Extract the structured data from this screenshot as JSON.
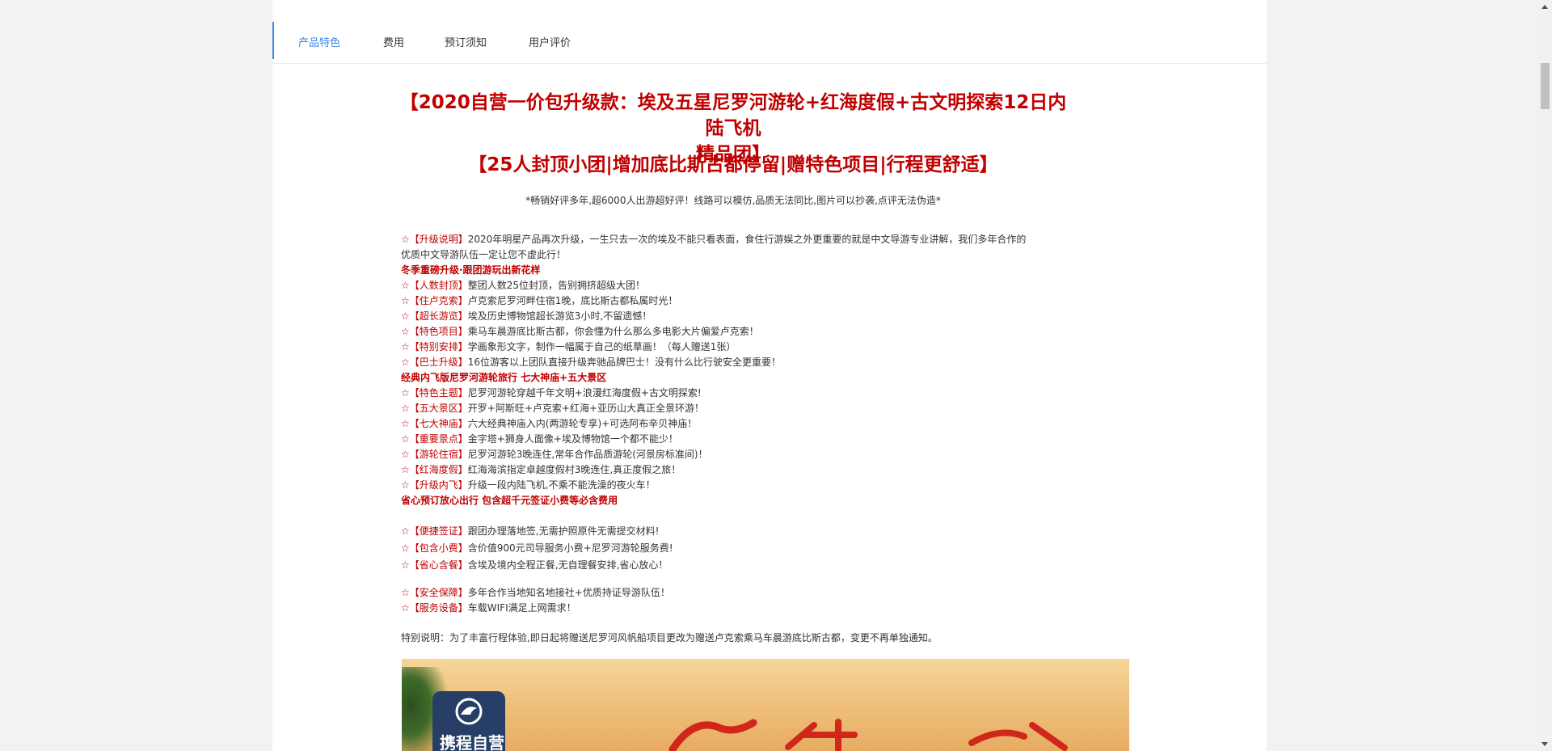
{
  "tabs": [
    {
      "label": "产品特色"
    },
    {
      "label": "费用"
    },
    {
      "label": "预订须知"
    },
    {
      "label": "用户评价"
    }
  ],
  "title_line1": "【2020自营一价包升级款：埃及五星尼罗河游轮+红海度假+古文明探索12日内陆飞机",
  "title_line2": "精品团】",
  "subtitle": "【25人封顶小团|增加底比斯古都停留|赠特色项目|行程更舒适】",
  "slogan": "*畅销好评多年,超6000人出游超好评！线路可以模仿,品质无法同比,图片可以抄袭,点评无法伪造*",
  "star": "☆",
  "section1": {
    "intro_tag": "【升级说明】",
    "intro_text": "2020年明星产品再次升级，一生只去一次的埃及不能只看表面，食住行游娱之外更重要的就是中文导游专业讲解，我们多年合作的",
    "intro_text2": "优质中文导游队伍一定让您不虚此行！",
    "heading": "冬季重磅升级·跟团游玩出新花样",
    "items": [
      {
        "tag": "【人数封顶】",
        "text": "整团人数25位封顶，告别拥挤超级大团！"
      },
      {
        "tag": "【住卢克索】",
        "text": "卢克索尼罗河畔住宿1晚，底比斯古都私属时光！"
      },
      {
        "tag": "【超长游览】",
        "text": "埃及历史博物馆超长游览3小时,不留遗憾！"
      },
      {
        "tag": "【特色项目】",
        "text": "乘马车晨游底比斯古都，你会懂为什么那么多电影大片偏爱卢克索！"
      },
      {
        "tag": "【特别安排】",
        "text": "学画象形文字，制作一幅属于自己的纸草画！（每人赠送1张）"
      },
      {
        "tag": "【巴士升级】",
        "text": "16位游客以上团队直接升级奔驰品牌巴士！没有什么比行驶安全更重要！"
      }
    ]
  },
  "section2": {
    "heading": " 经典内飞版尼罗河游轮旅行 七大神庙+五大景区",
    "items": [
      {
        "tag": "【特色主题】",
        "text": "尼罗河游轮穿越千年文明+浪漫红海度假+古文明探索!"
      },
      {
        "tag": "【五大景区】",
        "text": "开罗+阿斯旺+卢克索+红海+亚历山大真正全景环游！"
      },
      {
        "tag": "【七大神庙】",
        "text": "六大经典神庙入内(两游轮专享)+可选阿布辛贝神庙！"
      },
      {
        "tag": "【重要景点】",
        "text": "金字塔+狮身人面像+埃及博物馆一个都不能少！"
      },
      {
        "tag": "【游轮住宿】",
        "text": "尼罗河游轮3晚连住,常年合作品质游轮(河景房标准间)！"
      },
      {
        "tag": "【红海度假】",
        "text": "红海海滨指定卓越度假村3晚连住,真正度假之旅！"
      },
      {
        "tag": "【升级内飞】",
        "text": "升级一段内陆飞机,不乘不能洗澡的夜火车！"
      }
    ]
  },
  "section3": {
    "heading": " 省心预订放心出行 包含超千元签证小费等必含费用",
    "items": [
      {
        "tag": "【便捷签证】",
        "text": "跟团办理落地签,无需护照原件无需提交材料!"
      },
      {
        "tag": "【包含小费】",
        "text": "含价值900元司导服务小费+尼罗河游轮服务费!"
      },
      {
        "tag": "【省心含餐】",
        "text": "含埃及境内全程正餐,无自理餐安排,省心放心！"
      }
    ]
  },
  "section4": {
    "items": [
      {
        "tag": "【安全保障】",
        "text": "多年合作当地知名地接社+优质持证导游队伍！"
      },
      {
        "tag": "【服务设备】",
        "text": "车载WIFI满足上网需求！"
      }
    ]
  },
  "note": "特别说明：为了丰富行程体验,即日起将赠送尼罗河风帆船项目更改为赠送卢克索乘马车晨游底比斯古都，变更不再单独通知。",
  "banner": {
    "logo_text": "携程自营"
  },
  "colors": {
    "accent": "#3b86e3",
    "highlight": "#c00000",
    "text": "#333333",
    "banner": "#efc07a"
  },
  "icons": [
    "star-icon",
    "dolphin-logo-icon",
    "scroll-up-arrow-icon",
    "scroll-down-arrow-icon"
  ]
}
